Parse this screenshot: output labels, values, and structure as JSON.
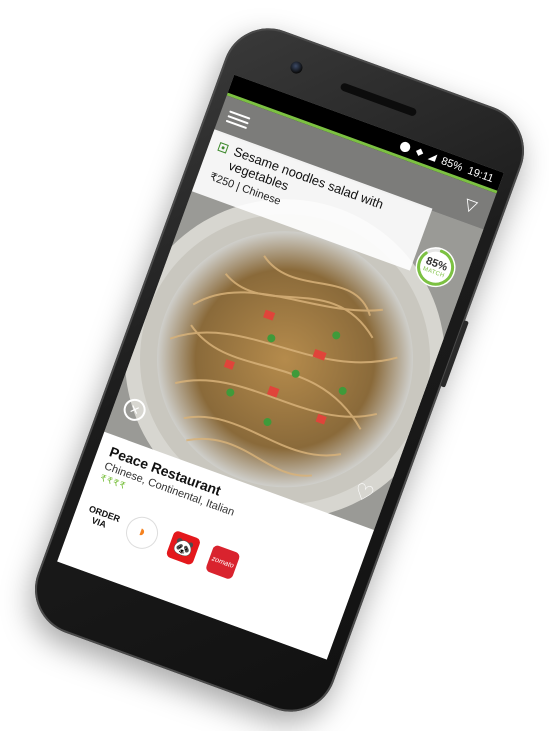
{
  "status_bar": {
    "battery": "85%",
    "time": "19:11"
  },
  "dish": {
    "name": "Sesame noodles salad with vegetables",
    "price": "₹250",
    "separator": "|",
    "cuisine": "Chinese"
  },
  "match": {
    "percent": "85%",
    "label": "MATCH",
    "value": 0.85
  },
  "restaurant": {
    "name": "Peace Restaurant",
    "cuisines": "Chinese, Continental, Italian",
    "price_level": "₹₹₹₹"
  },
  "order": {
    "label_line1": "ORDER",
    "label_line2": "VIA",
    "partners": [
      {
        "name": "swiggy",
        "glyph": "◗"
      },
      {
        "name": "foodpanda",
        "glyph": "🐼"
      },
      {
        "name": "zomato",
        "glyph": "zomato"
      }
    ]
  },
  "colors": {
    "accent_green": "#7cc142",
    "veg_green": "#3e8a2d",
    "zomato_red": "#d9232e",
    "foodpanda_red": "#e4181c"
  }
}
